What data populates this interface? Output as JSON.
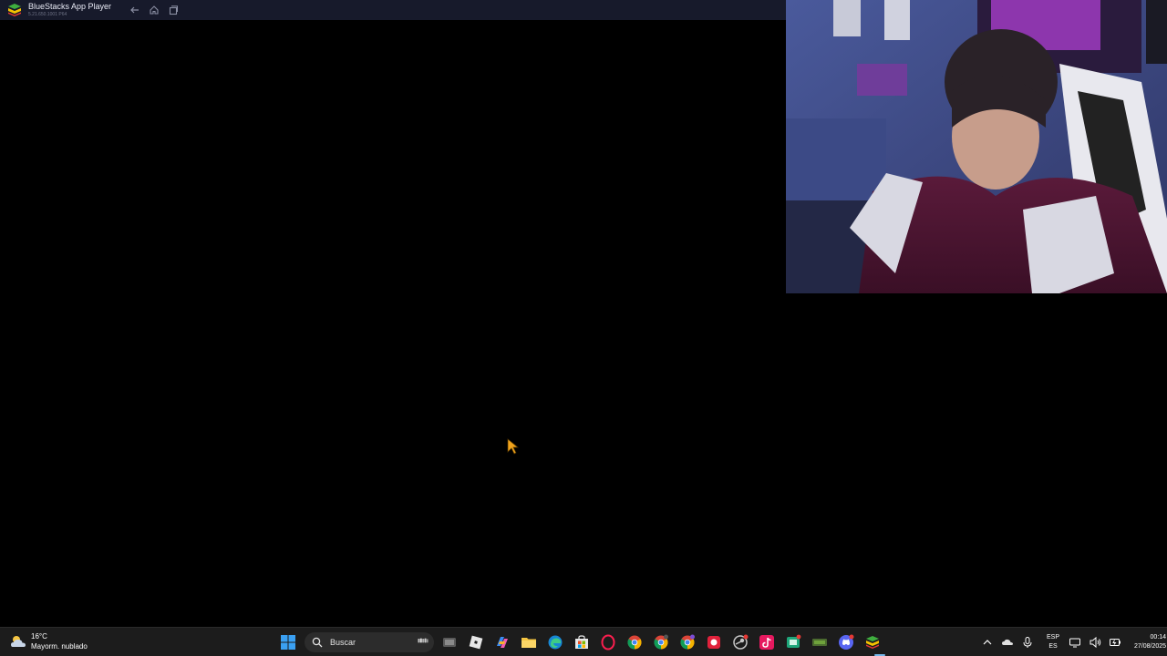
{
  "window": {
    "app_title": "BlueStacks App Player",
    "app_version": "5.21.650.1001 P64",
    "nav": [
      "back-icon",
      "home-icon",
      "multi-instance-icon"
    ]
  },
  "taskbar": {
    "weather": {
      "temperature": "16°C",
      "condition": "Mayorm. nublado",
      "icon": "cloudy-weather-icon"
    },
    "search_placeholder": "Buscar",
    "pinned_apps": [
      "windows-start-icon",
      "task-view-icon",
      "roblox-icon",
      "copilot-icon",
      "file-explorer-icon",
      "edge-icon",
      "microsoft-store-icon",
      "opera-gx-icon",
      "chrome-icon",
      "chrome-profile-icon",
      "chrome-profile-2-icon",
      "record-app-icon",
      "steam-icon",
      "tiktok-icon",
      "capture-app-icon",
      "nvidia-icon",
      "discord-icon",
      "bluestacks-icon"
    ],
    "tray": {
      "language_line1": "ESP",
      "language_line2": "ES",
      "time": "00:14",
      "date": "27/08/2025"
    },
    "accent_color": "#76b9ed"
  }
}
